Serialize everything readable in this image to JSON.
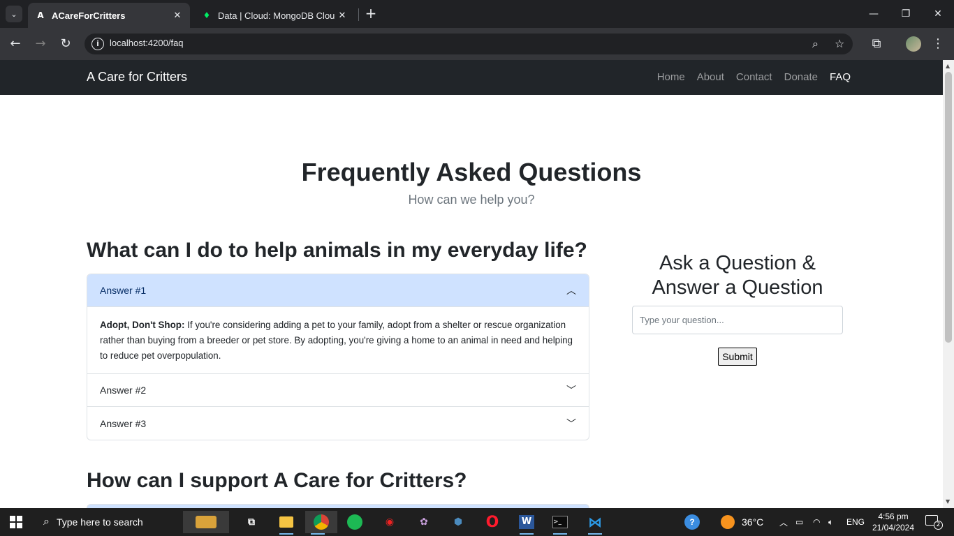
{
  "browser": {
    "tabs": [
      {
        "title": "ACareForCritters",
        "favicon": "angular-icon",
        "active": true
      },
      {
        "title": "Data | Cloud: MongoDB Cloud",
        "favicon": "mongodb-leaf-icon",
        "active": false
      }
    ],
    "url": "localhost:4200/faq"
  },
  "site": {
    "brand": "A Care for Critters",
    "nav": [
      "Home",
      "About",
      "Contact",
      "Donate",
      "FAQ"
    ],
    "active_nav": "FAQ"
  },
  "page": {
    "title": "Frequently Asked Questions",
    "subtitle": "How can we help you?"
  },
  "section1": {
    "heading": "What can I do to help animals in my everyday life?",
    "items": [
      {
        "label": "Answer #1",
        "open": true,
        "body_bold": "Adopt, Don't Shop:",
        "body_text": " If you're considering adding a pet to your family, adopt from a shelter or rescue organization rather than buying from a breeder or pet store. By adopting, you're giving a home to an animal in need and helping to reduce pet overpopulation."
      },
      {
        "label": "Answer #2",
        "open": false
      },
      {
        "label": "Answer #3",
        "open": false
      }
    ]
  },
  "section2": {
    "heading": "How can I support A Care for Critters?"
  },
  "ask": {
    "title": "Ask a Question & Answer a Question",
    "placeholder": "Type your question...",
    "submit_label": "Submit"
  },
  "taskbar": {
    "search_placeholder": "Type here to search",
    "weather": "36°C",
    "language": "ENG",
    "time": "4:56 pm",
    "date": "21/04/2024",
    "notifications": "2"
  },
  "colors": {
    "navbar_bg": "#212529",
    "accordion_open_bg": "#cfe2ff",
    "browser_bg": "#202124"
  }
}
